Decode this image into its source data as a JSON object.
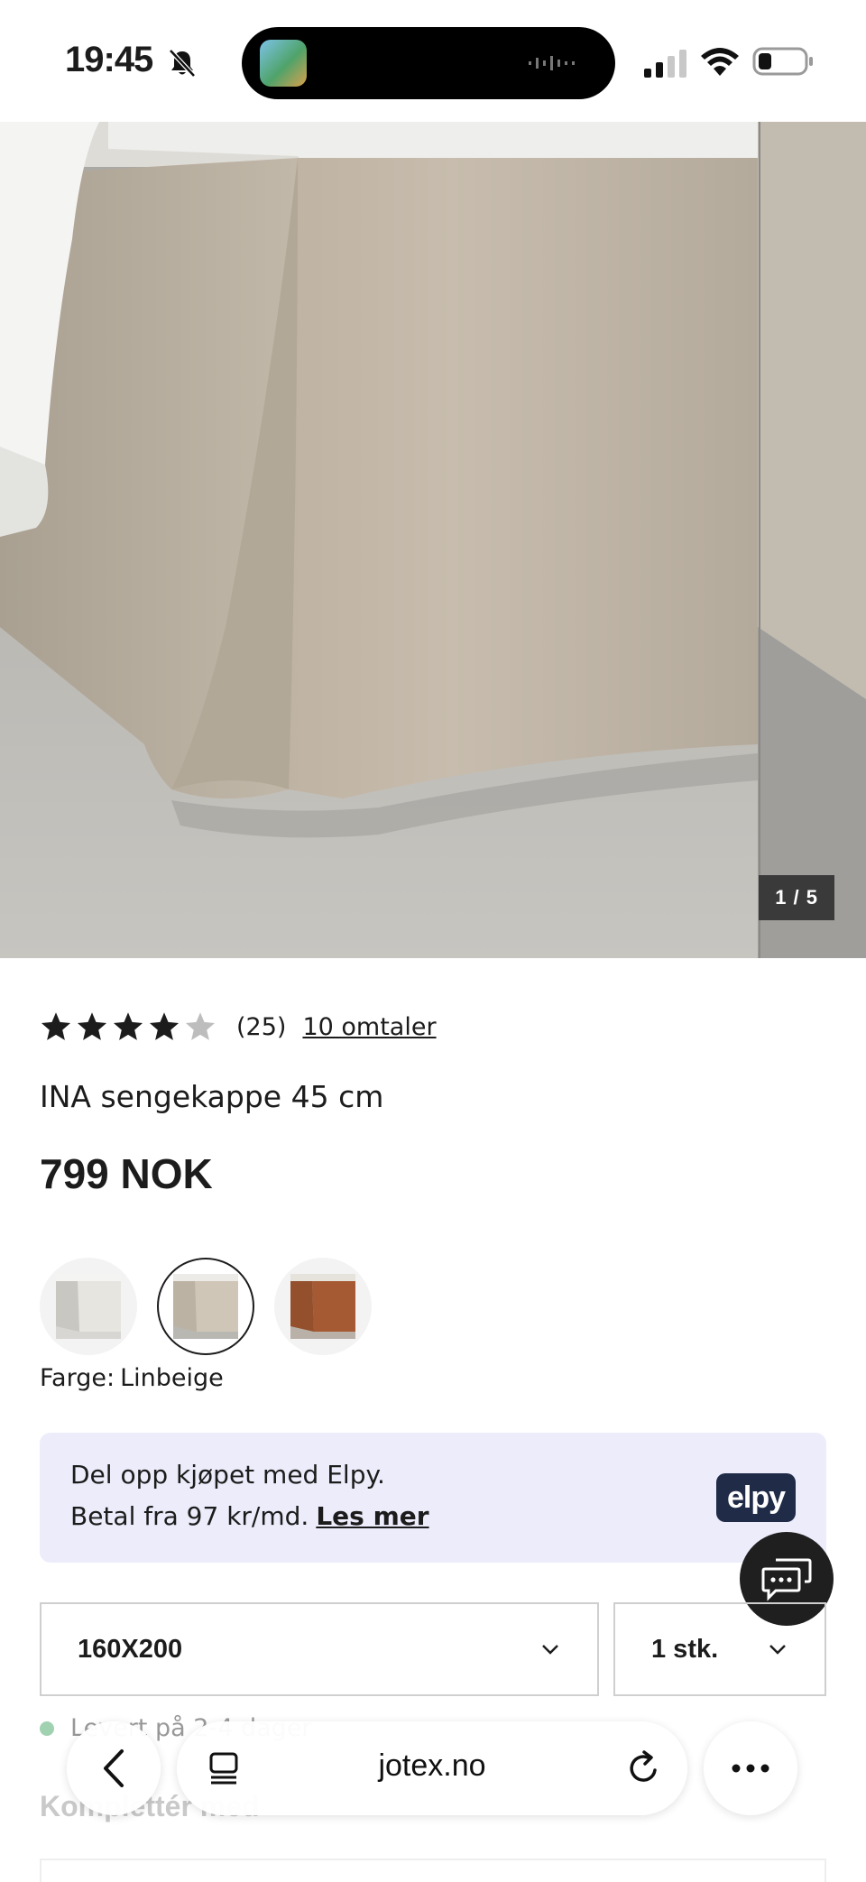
{
  "status_bar": {
    "time": "19:45"
  },
  "gallery": {
    "counter": "1 / 5"
  },
  "product": {
    "rating_value": 4,
    "rating_max": 5,
    "rating_count": "(25)",
    "reviews_link": "10 omtaler",
    "title": "INA sengekappe 45 cm",
    "price": "799 NOK",
    "color_label": "Farge:",
    "color_value": "Linbeige",
    "swatch_colors": [
      "#e6e5e0",
      "#cfc6b7",
      "#a55a33"
    ]
  },
  "elpy": {
    "line1": "Del opp kjøpet med Elpy.",
    "line2": "Betal fra 97 kr/md.",
    "link": "Les mer",
    "logo": "elpy",
    "logo_color": "#1f2b47",
    "background": "#ececfb"
  },
  "options": {
    "size_value": "160X200",
    "quantity_value": "1 stk."
  },
  "stock": {
    "text": "Levert på 2-4 dager"
  },
  "section": {
    "heading": "Komplettér med"
  },
  "browser": {
    "url": "jotex.no"
  },
  "icons": {
    "bell": "bell-slash-icon",
    "chat": "chat-icon",
    "back": "chevron-left-icon",
    "tabs": "tabs-icon",
    "reload": "reload-icon",
    "more": "more-icon"
  }
}
